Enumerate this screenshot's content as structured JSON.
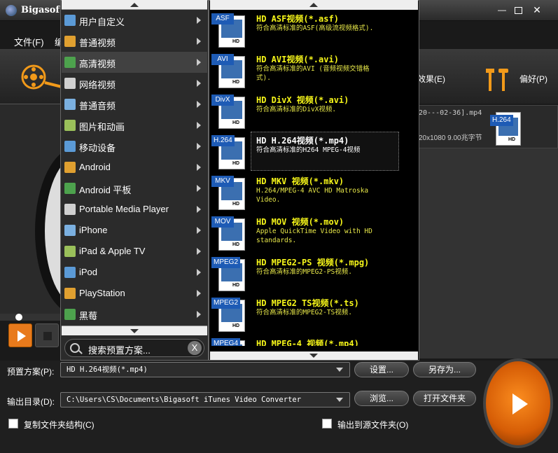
{
  "window": {
    "title": "Bigasoft"
  },
  "menubar": {
    "items": [
      "文件(F)",
      "编"
    ]
  },
  "toolbar": {
    "effect_label": "效果(E)",
    "prefs_label": "偏好(P)"
  },
  "file_list": {
    "name": "20---02-36].mp4",
    "info": "20x1080 9.00兆字节",
    "badge": "H.264",
    "hd": "HD"
  },
  "category_menu": {
    "items": [
      {
        "label": "用户自定义",
        "icon": "user-icon"
      },
      {
        "label": "普通视频",
        "icon": "video-icon"
      },
      {
        "label": "高清视频",
        "icon": "hd-icon",
        "selected": true
      },
      {
        "label": "网络视频",
        "icon": "web-video-icon"
      },
      {
        "label": "普通音频",
        "icon": "music-note-icon"
      },
      {
        "label": "图片和动画",
        "icon": "picture-icon"
      },
      {
        "label": "移动设备",
        "icon": "mobile-icon"
      },
      {
        "label": "Android",
        "icon": "android-icon"
      },
      {
        "label": "Android 平板",
        "icon": "android-tablet-icon"
      },
      {
        "label": "Portable Media Player",
        "icon": "media-player-icon"
      },
      {
        "label": "iPhone",
        "icon": "iphone-icon"
      },
      {
        "label": "iPad & Apple TV",
        "icon": "ipad-icon"
      },
      {
        "label": "iPod",
        "icon": "ipod-icon"
      },
      {
        "label": "PlayStation",
        "icon": "playstation-icon"
      },
      {
        "label": "黑莓",
        "icon": "blackberry-icon"
      }
    ],
    "search_placeholder": "搜索预置方案...",
    "search_clear": "X"
  },
  "format_menu": {
    "items": [
      {
        "badge": "ASF",
        "title": "HD ASF视频(*.asf)",
        "desc": "符合高清标准的ASF(高级流视频格式).",
        "hd": "HD"
      },
      {
        "badge": "AVI",
        "title": "HD AVI视频(*.avi)",
        "desc": "符合高清标准的AVI (音频视频交错格式).",
        "hd": "HD"
      },
      {
        "badge": "DivX",
        "title": "HD DivX 视频(*.avi)",
        "desc": "符合高清标准的DivX视频.",
        "hd": "HD"
      },
      {
        "badge": "H.264",
        "title": "HD H.264视频(*.mp4)",
        "desc": "符合高清标准的H264 MPEG-4视频",
        "hd": "HD",
        "selected": true
      },
      {
        "badge": "MKV",
        "title": "HD MKV 视频(*.mkv)",
        "desc": "H.264/MPEG-4 AVC HD Matroska Video.",
        "hd": "HD"
      },
      {
        "badge": "MOV",
        "title": "HD MOV 视频(*.mov)",
        "desc": "Apple QuickTime Video with HD standards.",
        "hd": "HD"
      },
      {
        "badge": "MPEG2",
        "title": "HD MPEG2-PS 视频(*.mpg)",
        "desc": "符合高清标准的MPEG2-PS视频.",
        "hd": "HD"
      },
      {
        "badge": "MPEG2",
        "title": "HD MPEG2 TS视频(*.ts)",
        "desc": "符合高清标准的MPEG2-TS视频.",
        "hd": "HD"
      },
      {
        "badge": "MPEG4",
        "title": "HD MPEG-4 视频(*.mp4)",
        "desc": "",
        "hd": "HD"
      }
    ]
  },
  "bottom": {
    "preset_label": "预置方案(P):",
    "preset_value": "HD H.264视频(*.mp4)",
    "settings_btn": "设置...",
    "saveas_btn": "另存为...",
    "output_label": "输出目录(D):",
    "output_value": "C:\\Users\\CS\\Documents\\Bigasoft iTunes Video Converter",
    "browse_btn": "浏览...",
    "open_folder_btn": "打开文件夹",
    "copy_structure": "复制文件夹结构(C)",
    "output_to_source": "输出到源文件夹(O)"
  },
  "colors": {
    "accent": "#e87a1c",
    "format_title": "#f7f719",
    "badge": "#1e5bb5"
  }
}
